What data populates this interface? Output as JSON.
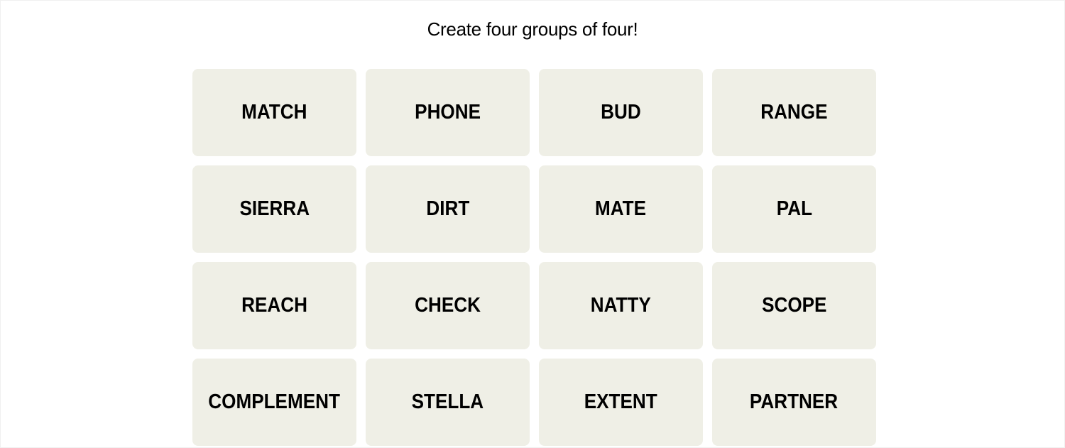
{
  "instructions": "Create four groups of four!",
  "colors": {
    "tile_background": "#efefe6",
    "text": "#000000",
    "page_background": "#ffffff"
  },
  "tiles": [
    {
      "word": "MATCH"
    },
    {
      "word": "PHONE"
    },
    {
      "word": "BUD"
    },
    {
      "word": "RANGE"
    },
    {
      "word": "SIERRA"
    },
    {
      "word": "DIRT"
    },
    {
      "word": "MATE"
    },
    {
      "word": "PAL"
    },
    {
      "word": "REACH"
    },
    {
      "word": "CHECK"
    },
    {
      "word": "NATTY"
    },
    {
      "word": "SCOPE"
    },
    {
      "word": "COMPLEMENT"
    },
    {
      "word": "STELLA"
    },
    {
      "word": "EXTENT"
    },
    {
      "word": "PARTNER"
    }
  ]
}
